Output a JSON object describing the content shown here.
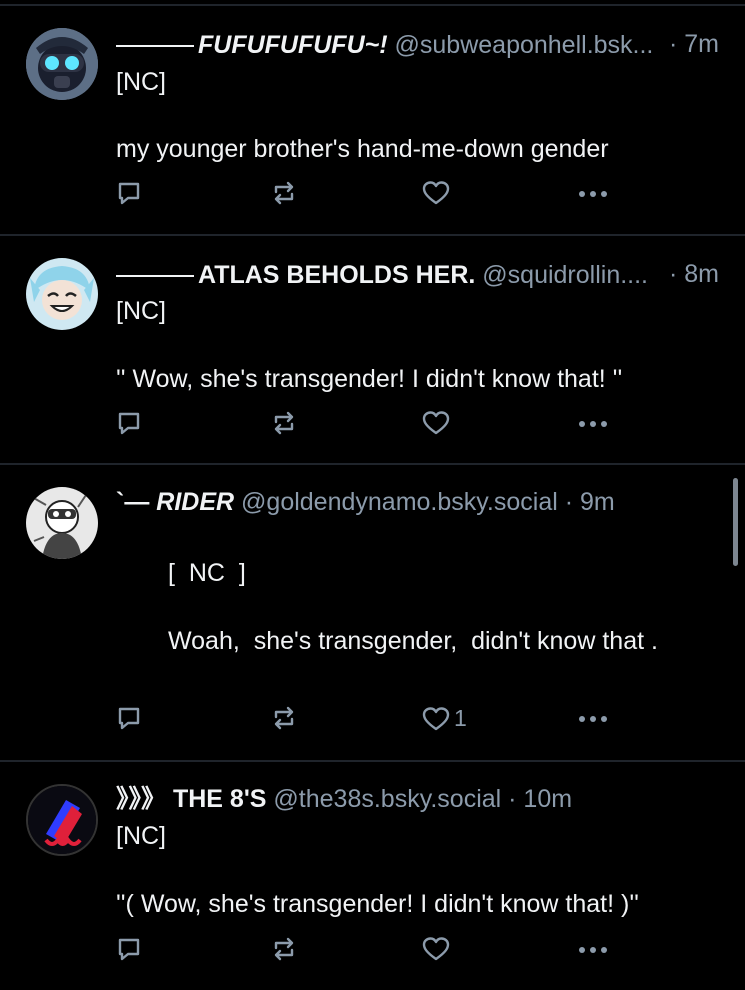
{
  "colors": {
    "background": "#000000",
    "text": "#f1f3f5",
    "muted": "#8c9bab",
    "divider": "#1f242b"
  },
  "posts": [
    {
      "name": "FUFUFUFUFU~!",
      "handle": "@subweaponhell.bsk...",
      "time": "· 7m",
      "line1": "[NC]",
      "line2": "my younger brother's hand-me-down gender",
      "like_count": "",
      "icons": [
        "reply-icon",
        "repost-icon",
        "like-icon",
        "more-icon"
      ]
    },
    {
      "name": "ATLAS BEHOLDS HER.",
      "handle": "@squidrollin....",
      "time": "· 8m",
      "line1": "[NC]",
      "line2": "'' Wow, she's transgender! I didn't know that! ''",
      "like_count": ""
    },
    {
      "prefix": "`—",
      "name": "RIDER",
      "handle": "@goldendynamo.bsky.social",
      "time": "· 9m",
      "line1": "[  NC  ]",
      "line2": "Woah,  she's transgender,  didn't know that .",
      "like_count": "1"
    },
    {
      "prefix": "》》》",
      "name": "THE 8'S",
      "handle": "@the38s.bsky.social",
      "time": "· 10m",
      "line1": "[NC]",
      "line2": "''( Wow, she's transgender! I didn't know that! )''",
      "like_count": ""
    }
  ]
}
